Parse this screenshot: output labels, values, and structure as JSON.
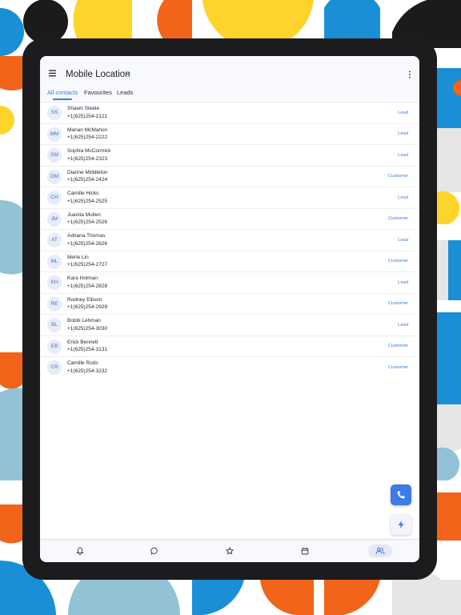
{
  "app": {
    "title": "Mobile Location"
  },
  "tabs": [
    {
      "label": "All contacts",
      "active": true
    },
    {
      "label": "Favourites",
      "active": false
    },
    {
      "label": "Leads",
      "active": false
    }
  ],
  "contacts": [
    {
      "initials": "SS",
      "name": "Shawn Steele",
      "phone": "+1(625)254-2121",
      "tag": "Lead"
    },
    {
      "initials": "MM",
      "name": "Marian McMahon",
      "phone": "+1(625)254-2222",
      "tag": "Lead"
    },
    {
      "initials": "SM",
      "name": "Sophia McCormick",
      "phone": "+1(625)254-2323",
      "tag": "Lead"
    },
    {
      "initials": "DM",
      "name": "Dianne Middleton",
      "phone": "+1(625)254-2424",
      "tag": "Customer"
    },
    {
      "initials": "CH",
      "name": "Camille Hicks",
      "phone": "+1(625)254-2525",
      "tag": "Lead"
    },
    {
      "initials": "JM",
      "name": "Juanita Mullen",
      "phone": "+1(625)254-2526",
      "tag": "Customer"
    },
    {
      "initials": "AT",
      "name": "Adriana Thomas",
      "phone": "+1(625)254-2626",
      "tag": "Lead"
    },
    {
      "initials": "ML",
      "name": "Merle Lin",
      "phone": "+1(625)254-2727",
      "tag": "Customer"
    },
    {
      "initials": "KH",
      "name": "Kara Holman",
      "phone": "+1(625)254-2828",
      "tag": "Lead"
    },
    {
      "initials": "RE",
      "name": "Rodney Ellison",
      "phone": "+1(625)254-2929",
      "tag": "Customer"
    },
    {
      "initials": "BL",
      "name": "Bobbi Lehman",
      "phone": "+1(625)254-3030",
      "tag": "Lead"
    },
    {
      "initials": "EB",
      "name": "Erick Bennett",
      "phone": "+1(625)254-3131",
      "tag": "Customer"
    },
    {
      "initials": "CR",
      "name": "Camille Rods",
      "phone": "+1(625)254-3232",
      "tag": "Customer"
    }
  ],
  "bottom_nav": [
    {
      "icon": "bell-icon",
      "active": false
    },
    {
      "icon": "chat-icon",
      "active": false
    },
    {
      "icon": "star-icon",
      "active": false
    },
    {
      "icon": "calendar-icon",
      "active": false
    },
    {
      "icon": "contacts-icon",
      "active": true
    }
  ],
  "colors": {
    "accent": "#3e7be6",
    "background_shapes": [
      "#ffd42a",
      "#f26419",
      "#1b1b1b",
      "#1a8fd6",
      "#93c2d6",
      "#e6e6e6"
    ]
  }
}
